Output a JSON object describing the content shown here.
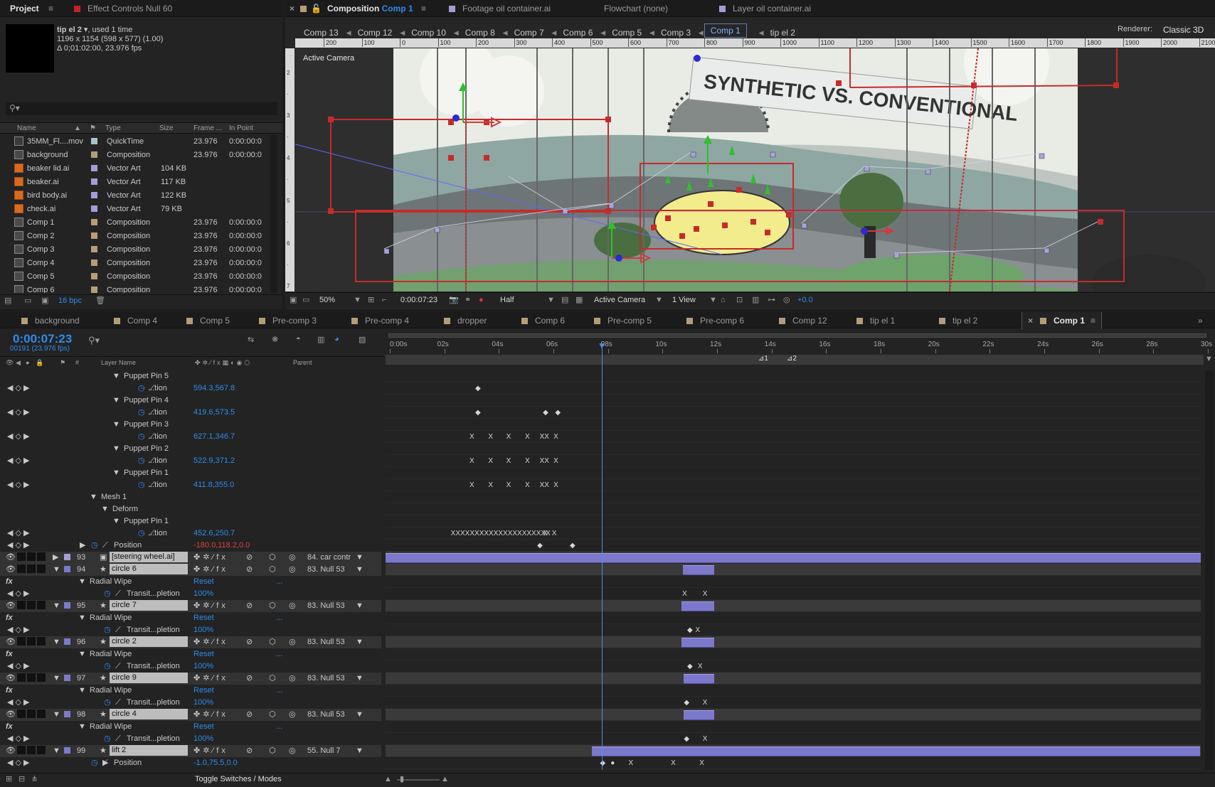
{
  "project": {
    "tab_label": "Project",
    "effect_tab_label": "Effect Controls Null 60",
    "item_name": "tip el 2 ▾",
    "item_used": ", used 1 time",
    "item_dims": "1196 x 1154  (598 x 577) (1.00)",
    "item_duration": "Δ 0;01:02:00, 23.976 fps",
    "columns": [
      "Name",
      "Type",
      "Size",
      "Frame ...",
      "In Point"
    ],
    "items": [
      {
        "name": "35MM_Fl....mov",
        "type": "QuickTime",
        "size": "",
        "frame": "23.976",
        "in": "0:00:00:0",
        "icon": "footage-icon",
        "label_color": "#a7c3c3"
      },
      {
        "name": "background",
        "type": "Composition",
        "size": "",
        "frame": "23.976",
        "in": "0:00:00:0",
        "icon": "composition-icon",
        "label_color": "#b59d78"
      },
      {
        "name": "beaker lid.ai",
        "type": "Vector Art",
        "size": "104 KB",
        "frame": "",
        "in": "",
        "icon": "illustrator-icon",
        "label_color": "#a69bd6"
      },
      {
        "name": "beaker.ai",
        "type": "Vector Art",
        "size": "117 KB",
        "frame": "",
        "in": "",
        "icon": "illustrator-icon",
        "label_color": "#a69bd6"
      },
      {
        "name": "bird body.ai",
        "type": "Vector Art",
        "size": "122 KB",
        "frame": "",
        "in": "",
        "icon": "illustrator-icon",
        "label_color": "#a69bd6"
      },
      {
        "name": "check.ai",
        "type": "Vector Art",
        "size": "79 KB",
        "frame": "",
        "in": "",
        "icon": "illustrator-icon",
        "label_color": "#a69bd6"
      },
      {
        "name": "Comp 1",
        "type": "Composition",
        "size": "",
        "frame": "23.976",
        "in": "0:00:00:0",
        "icon": "composition-icon",
        "label_color": "#b59d78"
      },
      {
        "name": "Comp 2",
        "type": "Composition",
        "size": "",
        "frame": "23.976",
        "in": "0:00:00:0",
        "icon": "composition-icon",
        "label_color": "#b59d78"
      },
      {
        "name": "Comp 3",
        "type": "Composition",
        "size": "",
        "frame": "23.976",
        "in": "0:00:00:0",
        "icon": "composition-icon",
        "label_color": "#b59d78"
      },
      {
        "name": "Comp 4",
        "type": "Composition",
        "size": "",
        "frame": "23.976",
        "in": "0:00:00:0",
        "icon": "composition-icon",
        "label_color": "#b59d78"
      },
      {
        "name": "Comp 5",
        "type": "Composition",
        "size": "",
        "frame": "23.976",
        "in": "0:00:00:0",
        "icon": "composition-icon",
        "label_color": "#b59d78"
      },
      {
        "name": "Comp 6",
        "type": "Composition",
        "size": "",
        "frame": "23.976",
        "in": "0:00:00:0",
        "icon": "composition-icon",
        "label_color": "#b59d78"
      }
    ],
    "bpc": "16 bpc"
  },
  "viewer": {
    "tabs": [
      {
        "label": "Composition",
        "sub": "Comp 1"
      },
      {
        "label": "Footage oil container.ai"
      },
      {
        "label": "Flowchart (none)"
      },
      {
        "label": "Layer oil container.ai"
      }
    ],
    "comp_nav": [
      "Comp 13",
      "Comp 12",
      "Comp 10",
      "Comp 8",
      "Comp 7",
      "Comp 6",
      "Comp 5",
      "Comp 3",
      "Comp 1",
      "tip el 2"
    ],
    "renderer_label": "Renderer:",
    "renderer_value": "Classic 3D",
    "camera_label": "Active Camera",
    "ruler": [
      "200",
      "100",
      "0",
      "100",
      "200",
      "300",
      "400",
      "500",
      "600",
      "700",
      "800",
      "900",
      "1000",
      "1100",
      "1200",
      "1300",
      "1400",
      "1500",
      "1600",
      "1700",
      "1800",
      "1900",
      "2000",
      "2100",
      "2200"
    ],
    "banner_text": "SYNTHETIC VS. CONVENTIONAL",
    "zoom": "50%",
    "timecode": "0:00:07:23",
    "resolution": "Half",
    "camera": "Active Camera",
    "views": "1 View",
    "exposure": "+0.0"
  },
  "timeline": {
    "tabs": [
      "background",
      "Comp 4",
      "Comp 5",
      "Pre-comp 3",
      "Pre-comp 4",
      "dropper",
      "Comp 6",
      "Pre-comp 5",
      "Pre-comp 6",
      "Comp 12",
      "tip el 1",
      "tip el 2",
      "Comp 1"
    ],
    "timecode": "0:00:07:23",
    "frame_info": "00191 (23.976 fps)",
    "col_layer_name": "Layer Name",
    "col_parent": "Parent",
    "ruler": [
      "0:00s",
      "02s",
      "04s",
      "06s",
      "08s",
      "10s",
      "12s",
      "14s",
      "16s",
      "18s",
      "20s",
      "22s",
      "24s",
      "26s",
      "28s",
      "30s"
    ],
    "markers": [
      "1",
      "2"
    ],
    "rows": [
      {
        "kind": "group",
        "indent": 2,
        "label": "Puppet Pin 5"
      },
      {
        "kind": "prop",
        "indent": 3,
        "label": "...tion",
        "value": "594.3,567.8",
        "kf": [
          [
            11.0,
            "◆"
          ]
        ]
      },
      {
        "kind": "group",
        "indent": 2,
        "label": "Puppet Pin 4"
      },
      {
        "kind": "prop",
        "indent": 3,
        "label": "...tion",
        "value": "419.6,573.5",
        "kf": [
          [
            11.0,
            "◆"
          ],
          [
            19.3,
            "◆"
          ],
          [
            20.8,
            "◆"
          ]
        ]
      },
      {
        "kind": "group",
        "indent": 2,
        "label": "Puppet Pin 3"
      },
      {
        "kind": "prop",
        "indent": 3,
        "label": "...tion",
        "value": "627.1,346.7",
        "kf": [
          [
            10.3,
            "X"
          ],
          [
            12.6,
            "X"
          ],
          [
            14.8,
            "X"
          ],
          [
            17.1,
            "X"
          ],
          [
            18.9,
            "XX"
          ],
          [
            20.6,
            "X"
          ]
        ]
      },
      {
        "kind": "group",
        "indent": 2,
        "label": "Puppet Pin 2"
      },
      {
        "kind": "prop",
        "indent": 3,
        "label": "...tion",
        "value": "522.9,371.2",
        "kf": [
          [
            10.3,
            "X"
          ],
          [
            12.6,
            "X"
          ],
          [
            14.8,
            "X"
          ],
          [
            17.1,
            "X"
          ],
          [
            18.9,
            "XX"
          ],
          [
            20.6,
            "X"
          ]
        ]
      },
      {
        "kind": "group",
        "indent": 2,
        "label": "Puppet Pin 1"
      },
      {
        "kind": "prop",
        "indent": 3,
        "label": "...tion",
        "value": "411.8,355.0",
        "kf": [
          [
            10.3,
            "X"
          ],
          [
            12.6,
            "X"
          ],
          [
            14.8,
            "X"
          ],
          [
            17.1,
            "X"
          ],
          [
            18.9,
            "XX"
          ],
          [
            20.6,
            "X"
          ]
        ]
      },
      {
        "kind": "group",
        "indent": 0,
        "label": "Mesh 1"
      },
      {
        "kind": "group",
        "indent": 1,
        "label": "Deform"
      },
      {
        "kind": "group",
        "indent": 2,
        "label": "Puppet Pin 1"
      },
      {
        "kind": "prop",
        "indent": 3,
        "label": "...tion",
        "value": "452.6,250.7",
        "kf": [
          [
            8.0,
            "XXXXXXXXXXXXXXXXXXXXX"
          ],
          [
            19.3,
            "X"
          ],
          [
            20.4,
            "X"
          ]
        ]
      },
      {
        "kind": "prop",
        "indent": -1,
        "label": "Position",
        "value": "-180.0,118.2,0.0",
        "value_red": true,
        "kf": [
          [
            18.6,
            "◆"
          ],
          [
            22.6,
            "◆"
          ]
        ]
      },
      {
        "kind": "layer",
        "num": "93",
        "name": "[steering wheel.ai]",
        "parent": "84. car contr",
        "label_color": "#a69bd6",
        "bar": [
          0,
          100
        ]
      },
      {
        "kind": "layer",
        "num": "94",
        "name": "circle 6",
        "parent": "83. Null 53",
        "label_color": "#7c79cc",
        "bar": [
          36.5,
          40.3
        ]
      },
      {
        "kind": "fx",
        "label": "Radial Wipe",
        "value": "Reset"
      },
      {
        "kind": "prop",
        "indent": -1,
        "label": "Transit...pletion",
        "value": "100%",
        "kf": [
          [
            36.4,
            "X"
          ],
          [
            38.9,
            "X"
          ]
        ]
      },
      {
        "kind": "layer",
        "num": "95",
        "name": "circle 7",
        "parent": "83. Null 53",
        "label_color": "#7c79cc",
        "bar": [
          36.3,
          40.3
        ]
      },
      {
        "kind": "fx",
        "label": "Radial Wipe",
        "value": "Reset"
      },
      {
        "kind": "prop",
        "indent": -1,
        "label": "Transit...pletion",
        "value": "100%",
        "kf": [
          [
            37.0,
            "◆"
          ],
          [
            38.0,
            "X"
          ]
        ]
      },
      {
        "kind": "layer",
        "num": "96",
        "name": "circle 2",
        "parent": "83. Null 53",
        "label_color": "#7c79cc",
        "bar": [
          36.3,
          40.3
        ]
      },
      {
        "kind": "fx",
        "label": "Radial Wipe",
        "value": "Reset"
      },
      {
        "kind": "prop",
        "indent": -1,
        "label": "Transit...pletion",
        "value": "100%",
        "kf": [
          [
            37.0,
            "◆"
          ],
          [
            38.3,
            "X"
          ]
        ]
      },
      {
        "kind": "layer",
        "num": "97",
        "name": "circle 9",
        "parent": "83. Null 53",
        "label_color": "#7c79cc",
        "bar": [
          36.6,
          40.3
        ]
      },
      {
        "kind": "fx",
        "label": "Radial Wipe",
        "value": "Reset"
      },
      {
        "kind": "prop",
        "indent": -1,
        "label": "Transit...pletion",
        "value": "100%",
        "kf": [
          [
            36.6,
            "◆"
          ],
          [
            38.9,
            "X"
          ]
        ]
      },
      {
        "kind": "layer",
        "num": "98",
        "name": "circle 4",
        "parent": "83. Null 53",
        "label_color": "#7c79cc",
        "bar": [
          36.6,
          40.3
        ]
      },
      {
        "kind": "fx",
        "label": "Radial Wipe",
        "value": "Reset"
      },
      {
        "kind": "prop",
        "indent": -1,
        "label": "Transit...pletion",
        "value": "100%",
        "kf": [
          [
            36.6,
            "◆"
          ],
          [
            38.9,
            "X"
          ]
        ]
      },
      {
        "kind": "layer",
        "num": "99",
        "name": "lift 2",
        "parent": "55. Null 7",
        "label_color": "#7c79cc",
        "bar": [
          25.3,
          99.9
        ]
      },
      {
        "kind": "prop",
        "indent": -2,
        "label": "Position",
        "value": "-1.0,75.5,0.0",
        "kf": [
          [
            26.3,
            "◆"
          ],
          [
            27.6,
            "●"
          ],
          [
            29.8,
            "X"
          ],
          [
            35.0,
            "X"
          ],
          [
            38.5,
            "X"
          ]
        ]
      }
    ],
    "footer_label": "Toggle Switches / Modes"
  },
  "colors": {
    "accent": "#2d8ceb",
    "layer_bar": "#7c79cc",
    "warning": "#e33f3f"
  }
}
